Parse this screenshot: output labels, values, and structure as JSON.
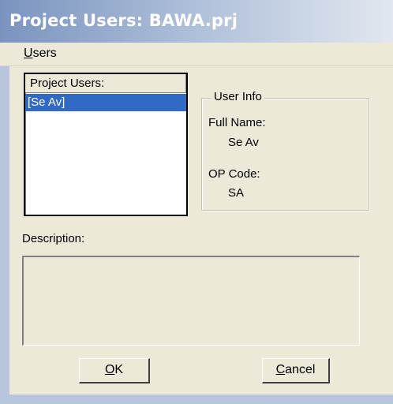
{
  "window": {
    "title": "Project Users: BAWA.prj"
  },
  "menu": {
    "users_label": "Users",
    "users_accel": "U",
    "users_rest": "sers"
  },
  "list": {
    "header": "Project Users:",
    "items": [
      {
        "label": "[Se Av]",
        "selected": true
      }
    ]
  },
  "user_info": {
    "legend": "User Info",
    "full_name_label": "Full Name:",
    "full_name_value": "Se Av",
    "op_code_label": "OP Code:",
    "op_code_value": "SA"
  },
  "description": {
    "label": "Description:",
    "value": ""
  },
  "buttons": {
    "ok_accel": "O",
    "ok_rest": "K",
    "cancel_accel": "C",
    "cancel_rest": "ancel"
  },
  "colors": {
    "selection": "#316ac5",
    "title_text": "#ffffff"
  }
}
